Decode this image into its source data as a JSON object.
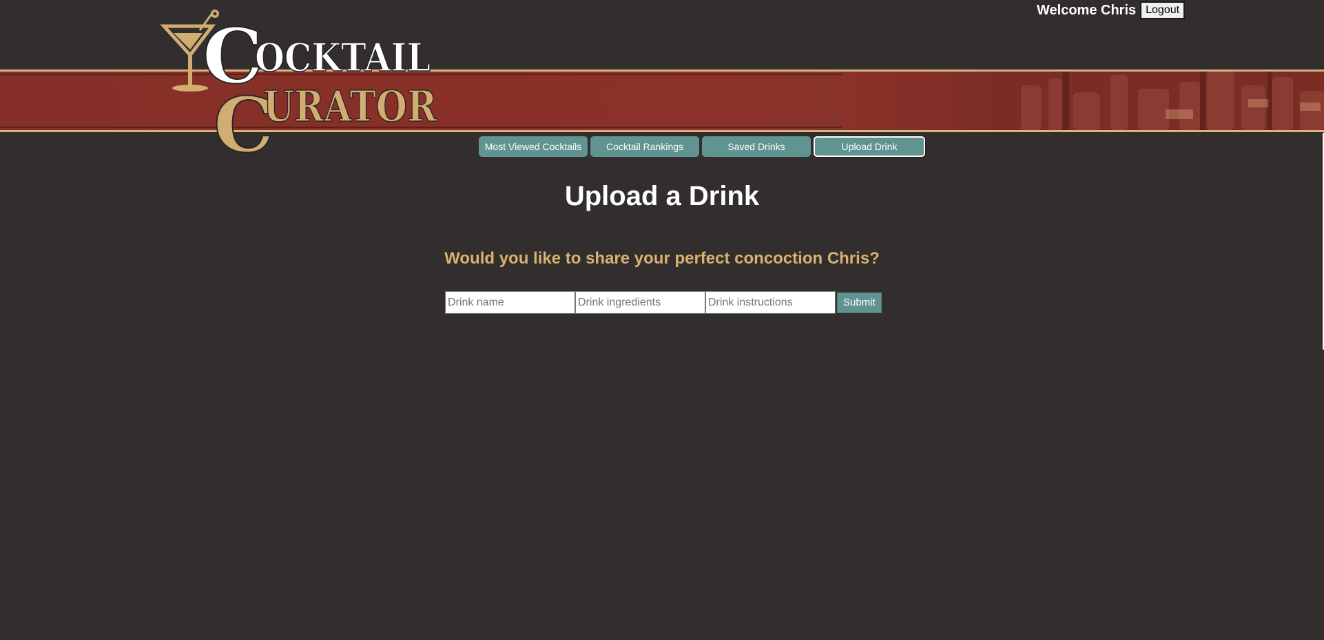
{
  "header": {
    "welcome_text": "Welcome Chris",
    "logout_label": "Logout"
  },
  "logo": {
    "line1": "OCKTAIL",
    "line2": "URATOR",
    "initial1": "C",
    "initial2": "C"
  },
  "nav": {
    "items": [
      {
        "label": "Most Viewed Cocktails",
        "active": false
      },
      {
        "label": "Cocktail Rankings",
        "active": false
      },
      {
        "label": "Saved Drinks",
        "active": false
      },
      {
        "label": "Upload Drink",
        "active": true
      }
    ]
  },
  "main": {
    "title": "Upload a Drink",
    "prompt": "Would you like to share your perfect concoction Chris?"
  },
  "form": {
    "name_placeholder": "Drink name",
    "ingredients_placeholder": "Drink ingredients",
    "instructions_placeholder": "Drink instructions",
    "submit_label": "Submit"
  },
  "colors": {
    "background": "#322e2e",
    "banner_red": "#852f28",
    "gold": "#d9b47f",
    "teal": "#5f9490",
    "prompt_gold": "#d9b16e"
  }
}
